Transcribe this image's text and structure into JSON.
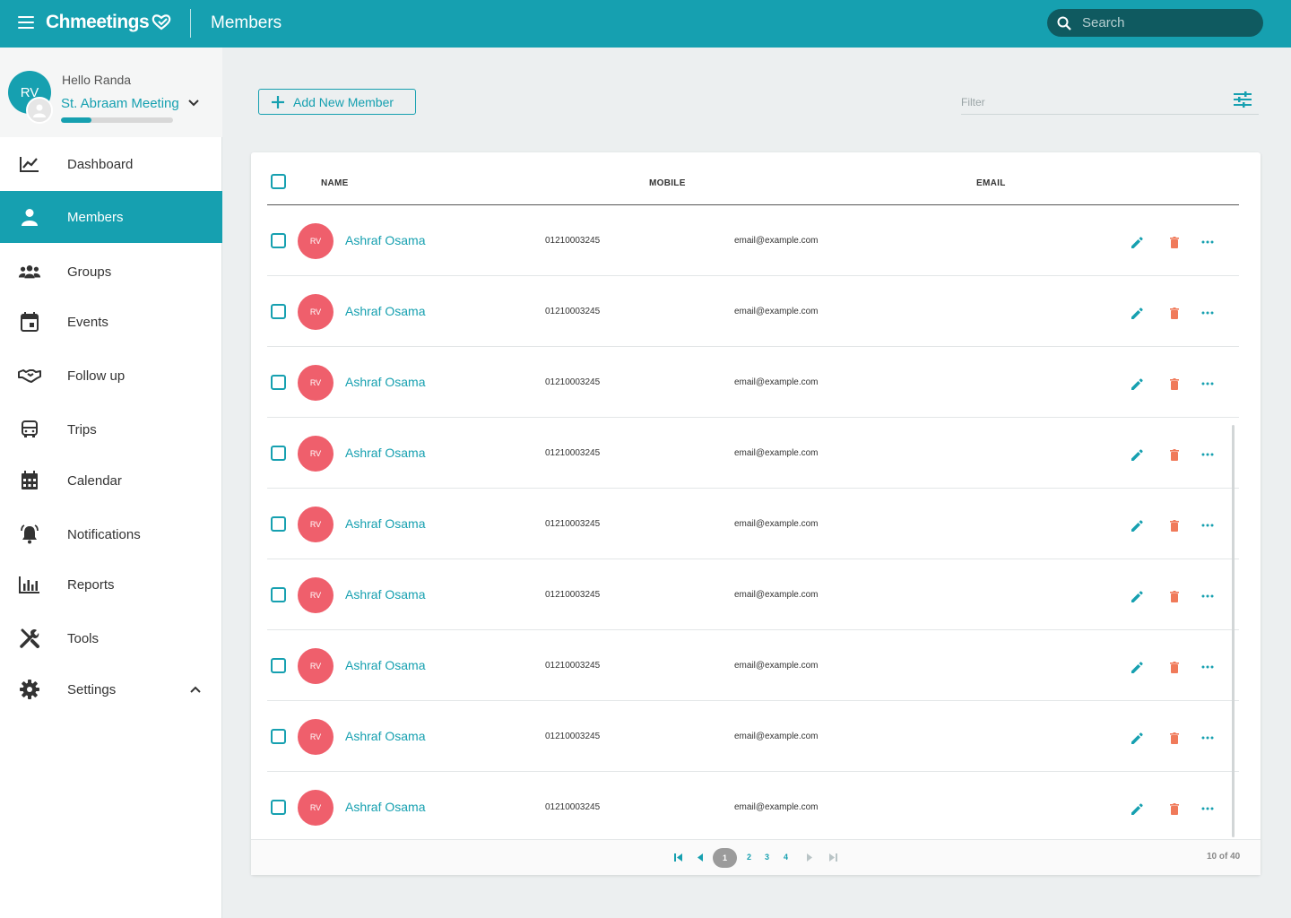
{
  "header": {
    "app_name": "Chmeetings",
    "page_title": "Members",
    "search_placeholder": "Search"
  },
  "colors": {
    "primary": "#16a0b0",
    "avatar": "#ef5f6c",
    "delete": "#f07a5a"
  },
  "profile": {
    "initials": "RV",
    "greeting": "Hello Randa",
    "meeting": "St. Abraam Meeting",
    "progress": 0.27
  },
  "sidebar": {
    "items": [
      {
        "label": "Dashboard",
        "icon": "chart-line-icon"
      },
      {
        "label": "Members",
        "icon": "person-icon",
        "active": true
      },
      {
        "label": "Groups",
        "icon": "groups-icon"
      },
      {
        "label": "Events",
        "icon": "event-icon"
      },
      {
        "label": "Follow up",
        "icon": "handshake-icon"
      },
      {
        "label": "Trips",
        "icon": "bus-icon"
      },
      {
        "label": "Calendar",
        "icon": "calendar-icon"
      },
      {
        "label": "Notifications",
        "icon": "bell-icon"
      },
      {
        "label": "Reports",
        "icon": "bar-chart-icon"
      },
      {
        "label": "Tools",
        "icon": "tools-icon"
      },
      {
        "label": "Settings",
        "icon": "gear-icon"
      }
    ]
  },
  "toolbar": {
    "add_label": "Add New Member",
    "filter_placeholder": "Filter"
  },
  "table": {
    "columns": [
      "NAME",
      "MOBILE",
      "EMAIL"
    ],
    "rows": [
      {
        "initials": "RV",
        "name": "Ashraf Osama",
        "mobile": "01210003245",
        "email": "email@example.com"
      },
      {
        "initials": "RV",
        "name": "Ashraf Osama",
        "mobile": "01210003245",
        "email": "email@example.com"
      },
      {
        "initials": "RV",
        "name": "Ashraf Osama",
        "mobile": "01210003245",
        "email": "email@example.com"
      },
      {
        "initials": "RV",
        "name": "Ashraf Osama",
        "mobile": "01210003245",
        "email": "email@example.com"
      },
      {
        "initials": "RV",
        "name": "Ashraf Osama",
        "mobile": "01210003245",
        "email": "email@example.com"
      },
      {
        "initials": "RV",
        "name": "Ashraf Osama",
        "mobile": "01210003245",
        "email": "email@example.com"
      },
      {
        "initials": "RV",
        "name": "Ashraf Osama",
        "mobile": "01210003245",
        "email": "email@example.com"
      },
      {
        "initials": "RV",
        "name": "Ashraf Osama",
        "mobile": "01210003245",
        "email": "email@example.com"
      },
      {
        "initials": "RV",
        "name": "Ashraf Osama",
        "mobile": "01210003245",
        "email": "email@example.com"
      }
    ]
  },
  "pagination": {
    "current": "1",
    "pages": [
      "2",
      "3",
      "4"
    ],
    "count_text": "10 of 40"
  }
}
